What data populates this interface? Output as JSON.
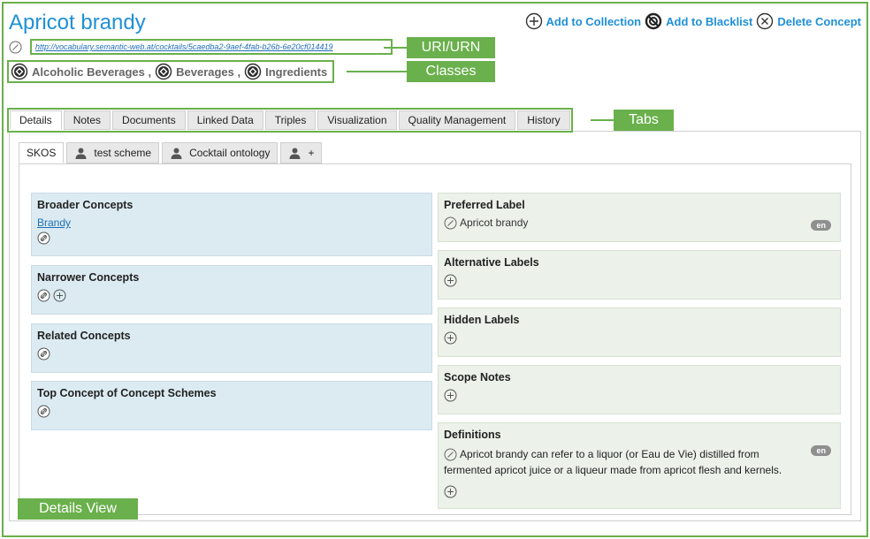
{
  "concept": {
    "title": "Apricot brandy",
    "uri": "http://vocabulary.semantic-web.at/cocktails/5caedba2-9aef-4fab-b26b-6e20cf014419",
    "classes": [
      "Alcoholic Beverages ,",
      "Beverages ,",
      "Ingredients"
    ]
  },
  "actions": {
    "add_collection": "Add to Collection",
    "add_blacklist": "Add to Blacklist",
    "delete": "Delete Concept"
  },
  "annotations": {
    "uri": "URI/URN",
    "classes": "Classes",
    "tabs": "Tabs",
    "details": "Details View"
  },
  "tabs": [
    "Details",
    "Notes",
    "Documents",
    "Linked Data",
    "Triples",
    "Visualization",
    "Quality Management",
    "History"
  ],
  "subtabs": {
    "skos": "SKOS",
    "test_scheme": "test scheme",
    "cocktail_ontology": "Cocktail ontology",
    "add": "+"
  },
  "left": {
    "broader": {
      "title": "Broader Concepts",
      "link": "Brandy"
    },
    "narrower": {
      "title": "Narrower Concepts"
    },
    "related": {
      "title": "Related Concepts"
    },
    "top": {
      "title": "Top Concept of Concept Schemes"
    }
  },
  "right": {
    "preferred": {
      "title": "Preferred Label",
      "value": "Apricot brandy",
      "lang": "en"
    },
    "alternative": {
      "title": "Alternative Labels"
    },
    "hidden": {
      "title": "Hidden Labels"
    },
    "scope": {
      "title": "Scope Notes"
    },
    "definitions": {
      "title": "Definitions",
      "value": "Apricot brandy can refer to a liquor (or Eau de Vie) distilled from fermented apricot juice or a liqueur made from apricot flesh and kernels.",
      "lang": "en"
    }
  },
  "colors": {
    "accent": "#1e90d6",
    "annotation": "#6ab04c"
  }
}
